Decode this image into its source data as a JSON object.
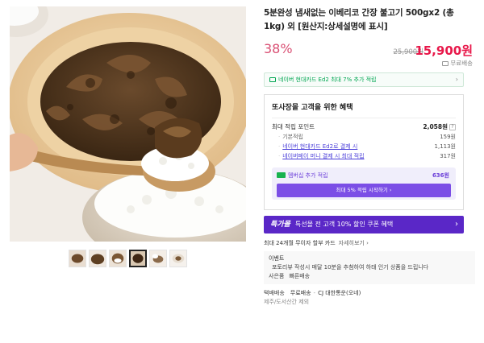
{
  "product": {
    "title": "5분완성 냄새없는 이베리코 간장 불고기 500gx2 (총 1kg) 외 [원산지:상세설명에 표시]",
    "discount": "38%",
    "original_price": "25,900원",
    "sale_price": "15,900원",
    "shipping": "무료배송"
  },
  "card_banner": {
    "text": "네이버 현대카드 Ed2 최대 7% 추가 적립"
  },
  "benefits": {
    "title": "또사장몰 고객을 위한 혜택",
    "max_points_label": "최대 적립 포인트",
    "max_points_value": "2,058원",
    "help_glyph": "?",
    "items": [
      {
        "label": "기본적립",
        "value": "159원",
        "link": false
      },
      {
        "label": "네이버 현대카드 Ed2로 결제 시",
        "value": "1,113원",
        "link": true
      },
      {
        "label": "네이버페이 머니 결제 시 최대 적립",
        "value": "317원",
        "link": true
      }
    ],
    "membership_label": "멤버십 추가 적립",
    "membership_value": "636원",
    "membership_button": "최대 5% 적립 시작하기 ›"
  },
  "coupon_banner": {
    "brand": "특가몰",
    "text": "특선몰 전 고객 10% 할인 쿠폰 혜택"
  },
  "installment": {
    "text": "최대 24개월 무이자 할부 카드",
    "more": "자세히보기"
  },
  "event": {
    "title": "이벤트",
    "description": "포토리뷰 작성시 매달 10분을 추첨하여 하태 인기 상품을 드립니다",
    "gift_label": "사은품",
    "gift_value": "빠른배송"
  },
  "delivery": {
    "label": "택배배송",
    "fee": "무료배송",
    "carrier": "CJ 대한통운(오네)",
    "region_note": "제주/도서산간 제외"
  },
  "colors": {
    "discount": "#d94f73",
    "sale_price": "#e8184a",
    "naver_green": "#00a651",
    "membership_purple": "#7b4ee6",
    "coupon_banner": "#5a27c7"
  },
  "icons": {
    "shipping": "truck-icon",
    "card": "card-icon",
    "help": "question-icon",
    "membership": "membership-badge-icon",
    "chevron": "chevron-right-icon"
  }
}
